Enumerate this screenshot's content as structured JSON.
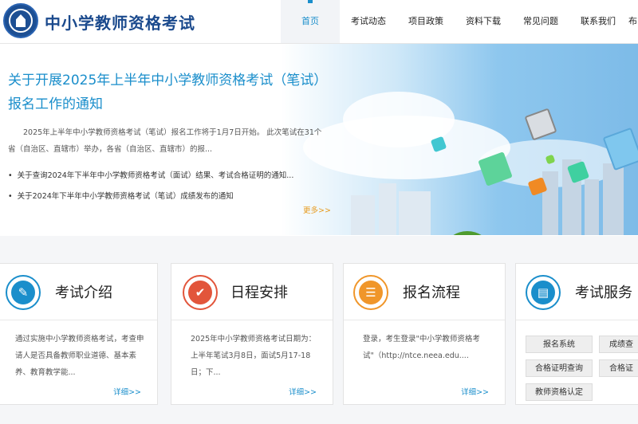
{
  "header": {
    "site_title": "中小学教师资格考试",
    "nav": [
      {
        "label": "首页",
        "active": true
      },
      {
        "label": "考试动态"
      },
      {
        "label": "项目政策"
      },
      {
        "label": "资料下载"
      },
      {
        "label": "常见问题"
      },
      {
        "label": "联系我们"
      }
    ],
    "nav_overflow": "布"
  },
  "banner": {
    "notice_title": "关于开展2025年上半年中小学教师资格考试（笔试）报名工作的通知",
    "notice_body": "2025年上半年中小学教师资格考试（笔试）报名工作将于1月7日开始。  此次笔试在31个省（自治区、直辖市）举办，各省（自治区、直辖市）的报...",
    "news": [
      "关于查询2024年下半年中小学教师资格考试（面试）结果、考试合格证明的通知...",
      "关于2024年下半年中小学教师资格考试（笔试）成绩发布的通知"
    ],
    "more": "更多>>"
  },
  "cards": [
    {
      "title": "考试介绍",
      "icon": "document-edit-icon",
      "color": "#1a8ecb",
      "text": "通过实施中小学教师资格考试，考查申请人是否具备教师职业道德、基本素养、教育教学能...",
      "more": "详细>>"
    },
    {
      "title": "日程安排",
      "icon": "checkmark-icon",
      "color": "#e2553b",
      "text": "2025年中小学教师资格考试日期为：上半年笔试3月8日，面试5月17-18日；下...",
      "more": "详细>>"
    },
    {
      "title": "报名流程",
      "icon": "form-icon",
      "color": "#f0962a",
      "text": "登录，考生登录\"中小学教师资格考试\"（http://ntce.neea.edu....",
      "more": "详细>>"
    },
    {
      "title": "考试服务",
      "icon": "contact-book-icon",
      "color": "#1a8ecb",
      "buttons": [
        "报名系统",
        "成绩查",
        "合格证明查询",
        "合格证",
        "教师资格认定"
      ]
    }
  ]
}
